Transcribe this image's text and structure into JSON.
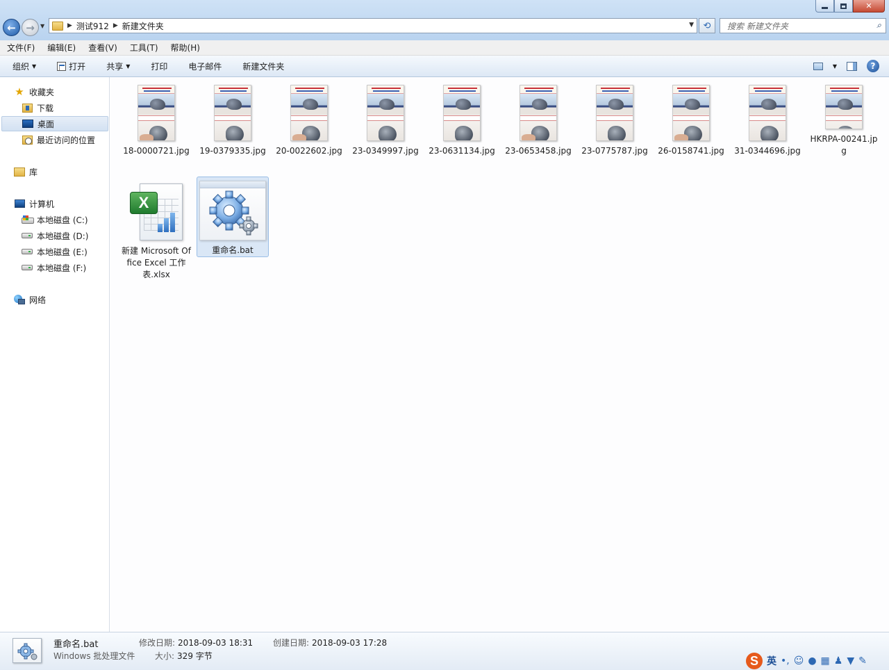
{
  "window": {
    "breadcrumb": [
      "测试912",
      "新建文件夹"
    ],
    "search_placeholder": "搜索 新建文件夹"
  },
  "menu": [
    "文件(F)",
    "编辑(E)",
    "查看(V)",
    "工具(T)",
    "帮助(H)"
  ],
  "toolbar": {
    "organize": "组织",
    "open": "打开",
    "share": "共享",
    "print": "打印",
    "email": "电子邮件",
    "new_folder": "新建文件夹"
  },
  "nav": {
    "favorites": "收藏夹",
    "downloads": "下载",
    "desktop": "桌面",
    "recent": "最近访问的位置",
    "libraries": "库",
    "computer": "计算机",
    "drive_c": "本地磁盘 (C:)",
    "drive_d": "本地磁盘 (D:)",
    "drive_e": "本地磁盘 (E:)",
    "drive_f": "本地磁盘 (F:)",
    "network": "网络"
  },
  "files": [
    {
      "name": "18-0000721.jpg",
      "type": "image"
    },
    {
      "name": "19-0379335.jpg",
      "type": "image"
    },
    {
      "name": "20-0022602.jpg",
      "type": "image"
    },
    {
      "name": "23-0349997.jpg",
      "type": "image"
    },
    {
      "name": "23-0631134.jpg",
      "type": "image"
    },
    {
      "name": "23-0653458.jpg",
      "type": "image"
    },
    {
      "name": "23-0775787.jpg",
      "type": "image"
    },
    {
      "name": "26-0158741.jpg",
      "type": "image"
    },
    {
      "name": "31-0344696.jpg",
      "type": "image"
    },
    {
      "name": "HKRPA-00241.jpg",
      "type": "image"
    },
    {
      "name": "新建 Microsoft Office Excel 工作表.xlsx",
      "type": "excel"
    },
    {
      "name": "重命名.bat",
      "type": "bat",
      "selected": true
    }
  ],
  "details": {
    "name": "重命名.bat",
    "type": "Windows 批处理文件",
    "modified_label": "修改日期:",
    "modified": "2018-09-03 18:31",
    "created_label": "创建日期:",
    "created": "2018-09-03 17:28",
    "size_label": "大小:",
    "size": "329 字节"
  },
  "ime": {
    "mode": "英"
  },
  "icons": {
    "back": "back-arrow-icon",
    "forward": "forward-arrow-icon",
    "refresh": "refresh-icon",
    "search": "search-icon",
    "help": "help-icon",
    "gear": "gear-icon"
  }
}
